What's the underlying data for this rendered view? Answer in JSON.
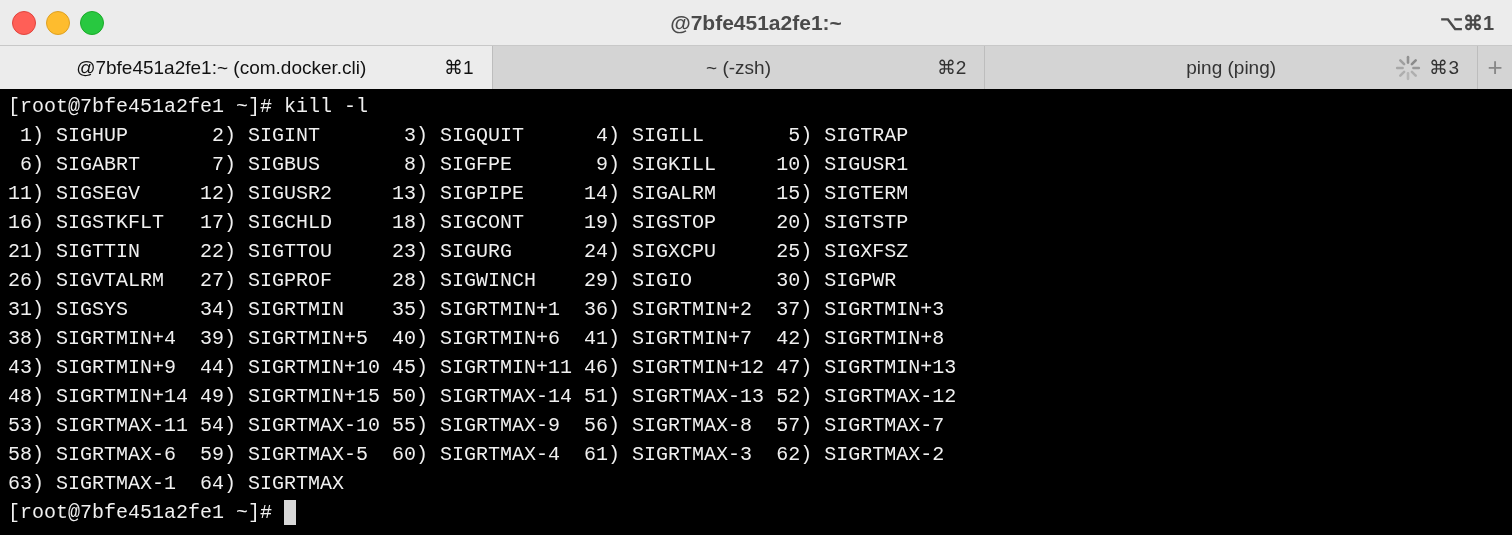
{
  "window": {
    "title": "@7bfe451a2fe1:~",
    "shortcut": "⌥⌘1"
  },
  "tabs": [
    {
      "label": "@7bfe451a2fe1:~ (com.docker.cli)",
      "shortcut": "⌘1",
      "selected": true,
      "busy": false
    },
    {
      "label": "~ (-zsh)",
      "shortcut": "⌘2",
      "selected": false,
      "busy": false
    },
    {
      "label": "ping (ping)",
      "shortcut": "⌘3",
      "selected": false,
      "busy": true
    }
  ],
  "new_tab": "+",
  "terminal": {
    "command_line": "[root@7bfe451a2fe1 ~]# kill -l",
    "signal_rows": [
      [
        " 1) SIGHUP",
        " 2) SIGINT",
        " 3) SIGQUIT",
        " 4) SIGILL",
        " 5) SIGTRAP"
      ],
      [
        " 6) SIGABRT",
        " 7) SIGBUS",
        " 8) SIGFPE",
        " 9) SIGKILL",
        "10) SIGUSR1"
      ],
      [
        "11) SIGSEGV",
        "12) SIGUSR2",
        "13) SIGPIPE",
        "14) SIGALRM",
        "15) SIGTERM"
      ],
      [
        "16) SIGSTKFLT",
        "17) SIGCHLD",
        "18) SIGCONT",
        "19) SIGSTOP",
        "20) SIGTSTP"
      ],
      [
        "21) SIGTTIN",
        "22) SIGTTOU",
        "23) SIGURG",
        "24) SIGXCPU",
        "25) SIGXFSZ"
      ],
      [
        "26) SIGVTALRM",
        "27) SIGPROF",
        "28) SIGWINCH",
        "29) SIGIO",
        "30) SIGPWR"
      ],
      [
        "31) SIGSYS",
        "34) SIGRTMIN",
        "35) SIGRTMIN+1",
        "36) SIGRTMIN+2",
        "37) SIGRTMIN+3"
      ],
      [
        "38) SIGRTMIN+4",
        "39) SIGRTMIN+5",
        "40) SIGRTMIN+6",
        "41) SIGRTMIN+7",
        "42) SIGRTMIN+8"
      ],
      [
        "43) SIGRTMIN+9",
        "44) SIGRTMIN+10",
        "45) SIGRTMIN+11",
        "46) SIGRTMIN+12",
        "47) SIGRTMIN+13"
      ],
      [
        "48) SIGRTMIN+14",
        "49) SIGRTMIN+15",
        "50) SIGRTMAX-14",
        "51) SIGRTMAX-13",
        "52) SIGRTMAX-12"
      ],
      [
        "53) SIGRTMAX-11",
        "54) SIGRTMAX-10",
        "55) SIGRTMAX-9",
        "56) SIGRTMAX-8",
        "57) SIGRTMAX-7"
      ],
      [
        "58) SIGRTMAX-6",
        "59) SIGRTMAX-5",
        "60) SIGRTMAX-4",
        "61) SIGRTMAX-3",
        "62) SIGRTMAX-2"
      ],
      [
        "63) SIGRTMAX-1",
        "64) SIGRTMAX"
      ]
    ],
    "prompt": "[root@7bfe451a2fe1 ~]#"
  }
}
